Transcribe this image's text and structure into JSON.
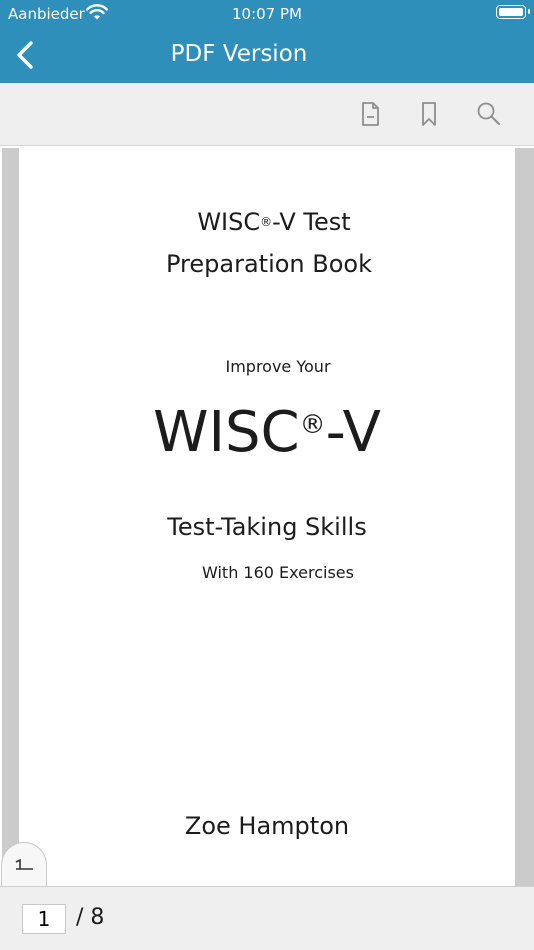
{
  "status_bar": {
    "carrier": "Aanbieder",
    "time": "10:07 PM"
  },
  "nav": {
    "title": "PDF Version"
  },
  "icons": {
    "back": "chevron-left-icon",
    "document": "document-icon",
    "bookmark": "bookmark-icon",
    "search": "search-icon",
    "page_tab": "page-number-icon"
  },
  "colors": {
    "accent": "#2e8fbb",
    "toolbar_bg": "#efefef",
    "gutter": "#cbcbcb"
  },
  "document": {
    "title_line1_prefix": "WISC",
    "title_line1_reg": "®",
    "title_line1_suffix": "-V Test",
    "title_line2": "Preparation Book",
    "improve": "Improve Your",
    "big_prefix": "WISC",
    "big_reg": "®",
    "big_suffix": "-V",
    "subtitle": "Test-Taking Skills",
    "exercises": "With 160 Exercises",
    "author": "Zoe Hampton"
  },
  "pager": {
    "current": "1",
    "total": "/ 8"
  }
}
